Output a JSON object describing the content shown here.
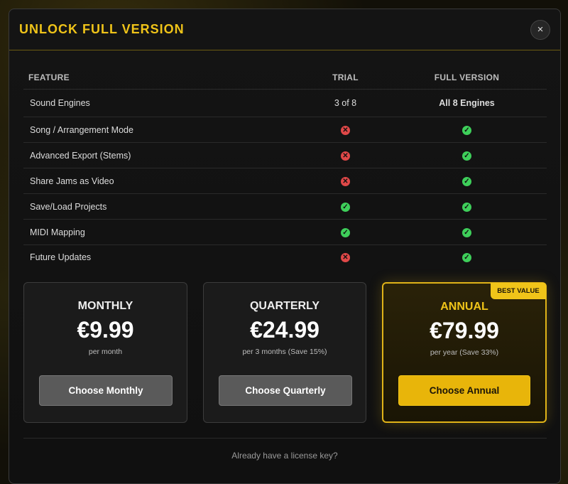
{
  "modal": {
    "title": "UNLOCK FULL VERSION",
    "close_label": "×"
  },
  "table": {
    "headers": {
      "feature": "FEATURE",
      "trial": "TRIAL",
      "full": "FULL VERSION"
    },
    "rows": [
      {
        "feature": "Sound Engines",
        "trial_text": "3 of 8",
        "full_text": "All 8 Engines"
      },
      {
        "feature": "Song / Arrangement Mode",
        "trial": false,
        "full": true
      },
      {
        "feature": "Advanced Export (Stems)",
        "trial": false,
        "full": true
      },
      {
        "feature": "Share Jams as Video",
        "trial": false,
        "full": true
      },
      {
        "feature": "Save/Load Projects",
        "trial": true,
        "full": true
      },
      {
        "feature": "MIDI Mapping",
        "trial": true,
        "full": true
      },
      {
        "feature": "Future Updates",
        "trial": false,
        "full": true
      }
    ]
  },
  "plans": [
    {
      "name": "MONTHLY",
      "price": "€9.99",
      "sub": "per month",
      "button": "Choose Monthly"
    },
    {
      "name": "QUARTERLY",
      "price": "€24.99",
      "sub": "per 3 months (Save 15%)",
      "button": "Choose Quarterly"
    },
    {
      "name": "ANNUAL",
      "price": "€79.99",
      "sub": "per year (Save 33%)",
      "button": "Choose Annual",
      "badge": "BEST VALUE"
    }
  ],
  "footer": {
    "license_link": "Already have a license key?"
  },
  "colors": {
    "accent": "#f0c419",
    "check": "#3ecf5a",
    "cross": "#e04848",
    "annual_button": "#e8b50a"
  },
  "icons": {
    "check": "check-circle-icon",
    "cross": "x-circle-icon",
    "close": "close-icon"
  }
}
